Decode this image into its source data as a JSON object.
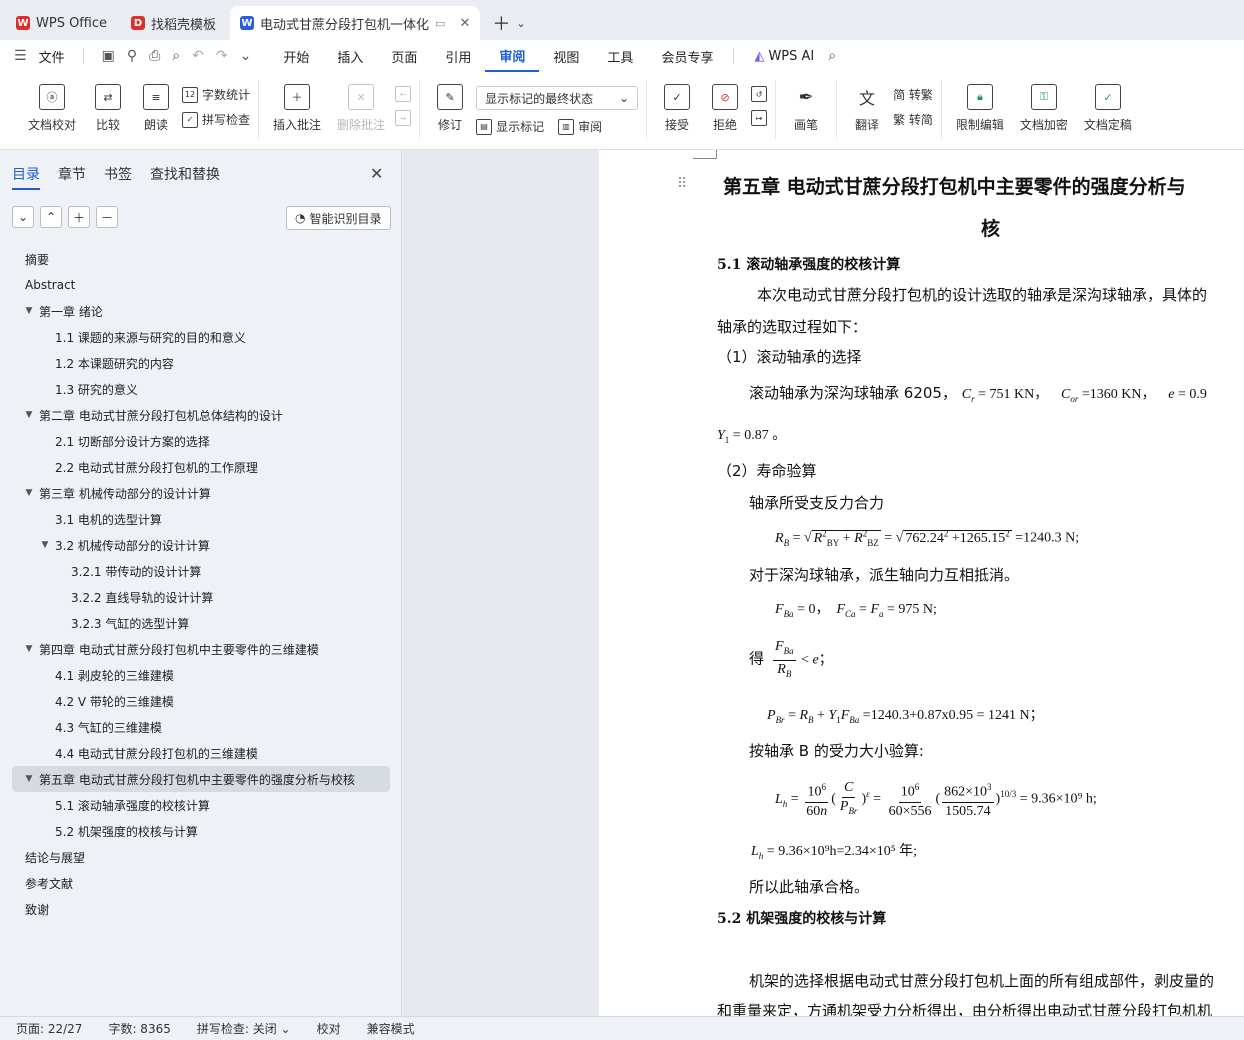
{
  "tabs": [
    {
      "label": "WPS Office",
      "color": "#d9302b",
      "icon": "wps-logo-icon",
      "active": false
    },
    {
      "label": "找稻壳模板",
      "color": "#d9302b",
      "icon": "docer-icon",
      "active": false
    },
    {
      "label": "电动式甘蔗分段打包机一体化",
      "color": "#2b5fd9",
      "icon": "word-doc-icon",
      "active": true
    }
  ],
  "menubar": {
    "file": "文件",
    "tabs": [
      "开始",
      "插入",
      "页面",
      "引用",
      "审阅",
      "视图",
      "工具",
      "会员专享"
    ],
    "active_tab": "审阅",
    "ai": "WPS AI"
  },
  "ribbon": {
    "doc_check": "文档校对",
    "compare": "比较",
    "read_aloud": "朗读",
    "word_count": "字数统计",
    "spell_check": "拼写检查",
    "insert_comment": "插入批注",
    "delete_comment": "删除批注",
    "revise": "修订",
    "markup_state": "显示标记的最终状态",
    "show_markup": "显示标记",
    "review": "审阅",
    "accept": "接受",
    "reject": "拒绝",
    "pen": "画笔",
    "translate": "翻译",
    "to_trad": "简 转繁",
    "to_simp": "繁 转简",
    "restrict_edit": "限制编辑",
    "encrypt": "文档加密",
    "finalize": "文档定稿"
  },
  "nav": {
    "tabs": [
      "目录",
      "章节",
      "书签",
      "查找和替换"
    ],
    "smart_toc": "智能识别目录",
    "toc": [
      {
        "label": "摘要",
        "level": 0,
        "expand": false
      },
      {
        "label": "Abstract",
        "level": 0,
        "expand": false
      },
      {
        "label": "第一章  绪论",
        "level": 0,
        "expand": true
      },
      {
        "label": "1.1  课题的来源与研究的目的和意义",
        "level": 1,
        "expand": false
      },
      {
        "label": "1.2  本课题研究的内容",
        "level": 1,
        "expand": false
      },
      {
        "label": "1.3  研究的意义",
        "level": 1,
        "expand": false
      },
      {
        "label": "第二章  电动式甘蔗分段打包机总体结构的设计",
        "level": 0,
        "expand": true
      },
      {
        "label": "2.1 切断部分设计方案的选择",
        "level": 1,
        "expand": false
      },
      {
        "label": "2.2 电动式甘蔗分段打包机的工作原理",
        "level": 1,
        "expand": false
      },
      {
        "label": "第三章  机械传动部分的设计计算",
        "level": 0,
        "expand": true
      },
      {
        "label": "3.1 电机的选型计算",
        "level": 1,
        "expand": false
      },
      {
        "label": "3.2  机械传动部分的设计计算",
        "level": 1,
        "expand": true
      },
      {
        "label": "3.2.1  带传动的设计计算",
        "level": 2,
        "expand": false
      },
      {
        "label": "3.2.2 直线导轨的设计计算",
        "level": 2,
        "expand": false
      },
      {
        "label": "3.2.3 气缸的选型计算",
        "level": 2,
        "expand": false
      },
      {
        "label": "第四章  电动式甘蔗分段打包机中主要零件的三维建模",
        "level": 0,
        "expand": true
      },
      {
        "label": "4.1 剥皮轮的三维建模",
        "level": 1,
        "expand": false
      },
      {
        "label": "4.2 V 带轮的三维建模",
        "level": 1,
        "expand": false
      },
      {
        "label": "4.3 气缸的三维建模",
        "level": 1,
        "expand": false
      },
      {
        "label": "4.4 电动式甘蔗分段打包机的三维建模",
        "level": 1,
        "expand": false
      },
      {
        "label": "第五章  电动式甘蔗分段打包机中主要零件的强度分析与校核",
        "level": 0,
        "expand": true,
        "selected": true
      },
      {
        "label": "5.1 滚动轴承强度的校核计算",
        "level": 1,
        "expand": false
      },
      {
        "label": "5.2 机架强度的校核与计算",
        "level": 1,
        "expand": false
      },
      {
        "label": "结论与展望",
        "level": 0,
        "expand": false
      },
      {
        "label": "参考文献",
        "level": 0,
        "expand": false
      },
      {
        "label": "致谢",
        "level": 0,
        "expand": false
      }
    ]
  },
  "doc": {
    "chapter_title": "第五章  电动式甘蔗分段打包机中主要零件的强度分析与",
    "chapter_title_cont": "核",
    "s51": "5.1 滚动轴承强度的校核计算",
    "p1": "本次电动式甘蔗分段打包机的设计选取的轴承是深沟球轴承，具体的",
    "p1b": "轴承的选取过程如下：",
    "step1": "（1）滚动轴承的选择",
    "bearing_line": "滚动轴承为深沟球轴承 6205，",
    "cr": "= 751 KN，",
    "cor": "=1360 KN，",
    "e_val": "= 0.9",
    "y1": "= 0.87 。",
    "step2": "（2）寿命验算",
    "p_force": "轴承所受支反力合力",
    "rb_eq": "=1240.3 N;",
    "p_axial": "对于深沟球轴承，派生轴向力互相抵消。",
    "fba": "= 0",
    "fca": "= 975 N;",
    "de": "得",
    "pbr": "=1240.3+0.87x0.95 = 1241 N；",
    "p_check": "按轴承 B 的受力大小验算:",
    "lh_res": "= 9.36×10⁹ h;",
    "lh2": "= 9.36×10⁹h=2.34×10⁵ 年;",
    "p_ok": "所以此轴承合格。",
    "s52": "5.2 机架强度的校核与计算",
    "p_frame": "机架的选择根据电动式甘蔗分段打包机上面的所有组成部件，剥皮量的",
    "p_frame2": "和重量来定，方通机架受力分析得出，由分析得出电动式甘蔗分段打包机机"
  },
  "status": {
    "page": "页面: 22/27",
    "words": "字数: 8365",
    "spell": "拼写检查: 关闭",
    "proof": "校对",
    "compat": "兼容模式"
  }
}
